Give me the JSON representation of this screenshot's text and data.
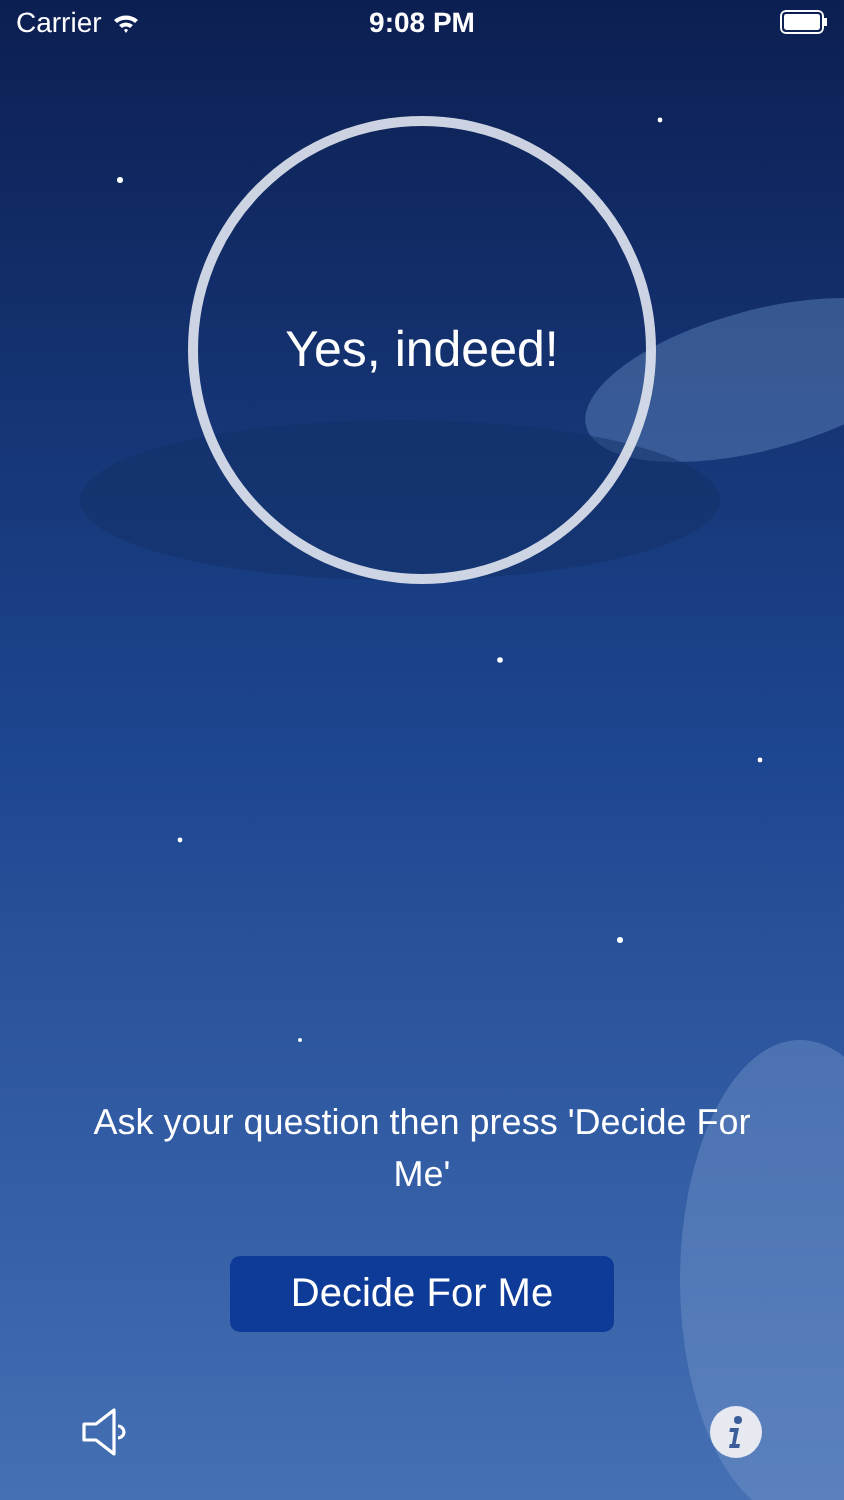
{
  "status_bar": {
    "carrier": "Carrier",
    "time": "9:08 PM"
  },
  "answer": "Yes, indeed!",
  "prompt": "Ask your question then press 'Decide For Me'",
  "decide_button": "Decide For Me"
}
